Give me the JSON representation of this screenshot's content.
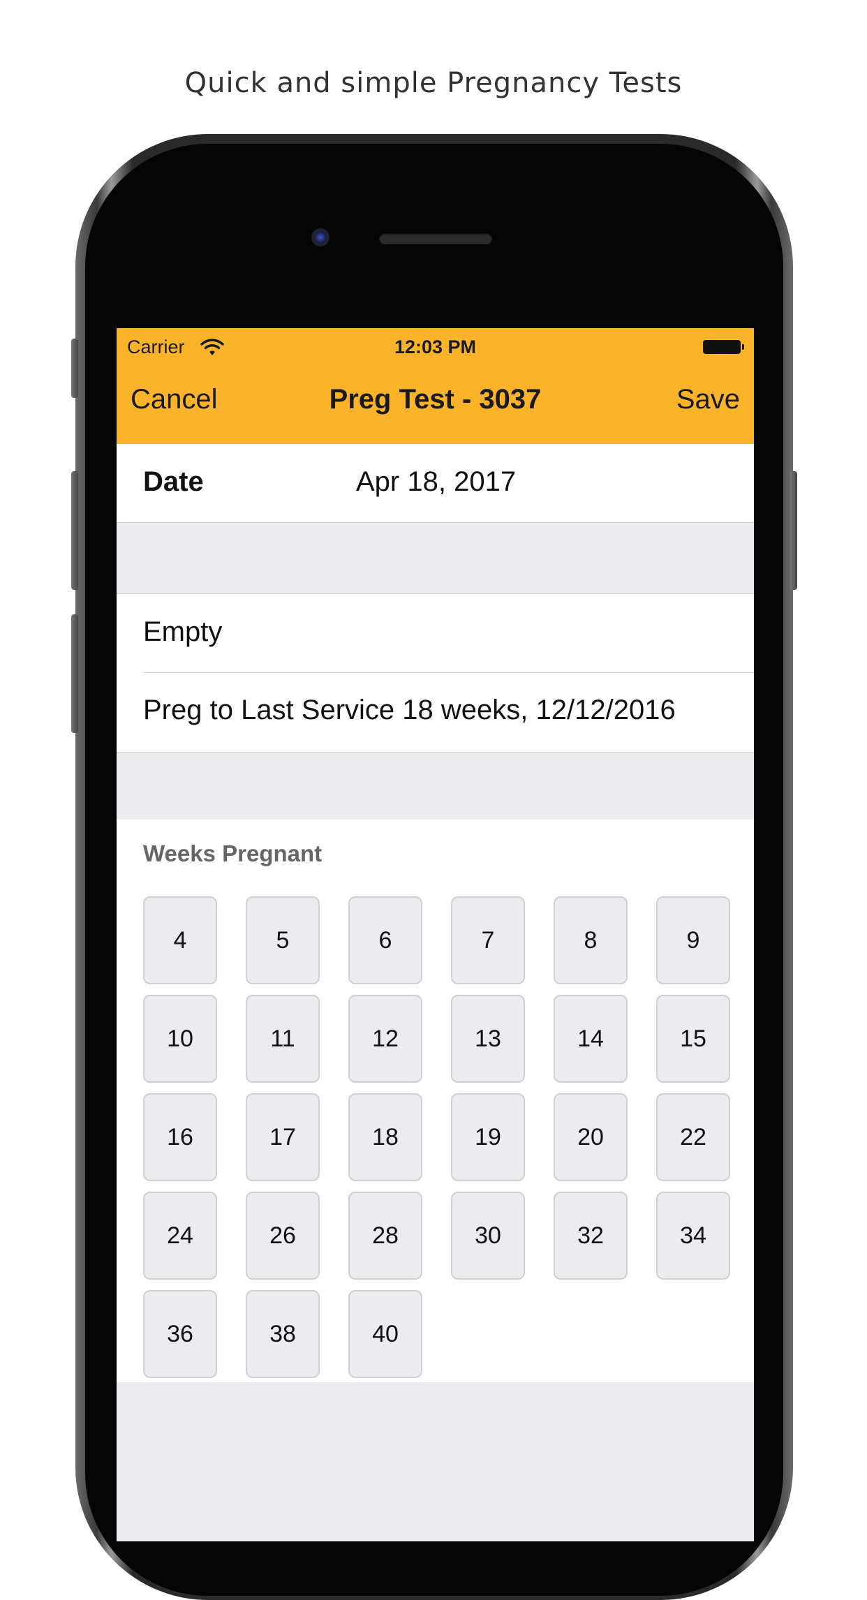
{
  "caption": "Quick and simple Pregnancy Tests",
  "colors": {
    "accent": "#fbb429",
    "background": "#ebebf0"
  },
  "status_bar": {
    "carrier": "Carrier",
    "time": "12:03 PM",
    "wifi_icon": "wifi-icon",
    "battery_icon": "battery-icon"
  },
  "nav": {
    "cancel_label": "Cancel",
    "title": "Preg Test - 3037",
    "save_label": "Save"
  },
  "date_row": {
    "label": "Date",
    "value": "Apr 18, 2017"
  },
  "results": [
    {
      "label": "Empty"
    },
    {
      "label": "Preg to Last Service 18 weeks, 12/12/2016"
    }
  ],
  "weeks": {
    "title": "Weeks Pregnant",
    "options": [
      "4",
      "5",
      "6",
      "7",
      "8",
      "9",
      "10",
      "11",
      "12",
      "13",
      "14",
      "15",
      "16",
      "17",
      "18",
      "19",
      "20",
      "22",
      "24",
      "26",
      "28",
      "30",
      "32",
      "34",
      "36",
      "38",
      "40"
    ]
  }
}
